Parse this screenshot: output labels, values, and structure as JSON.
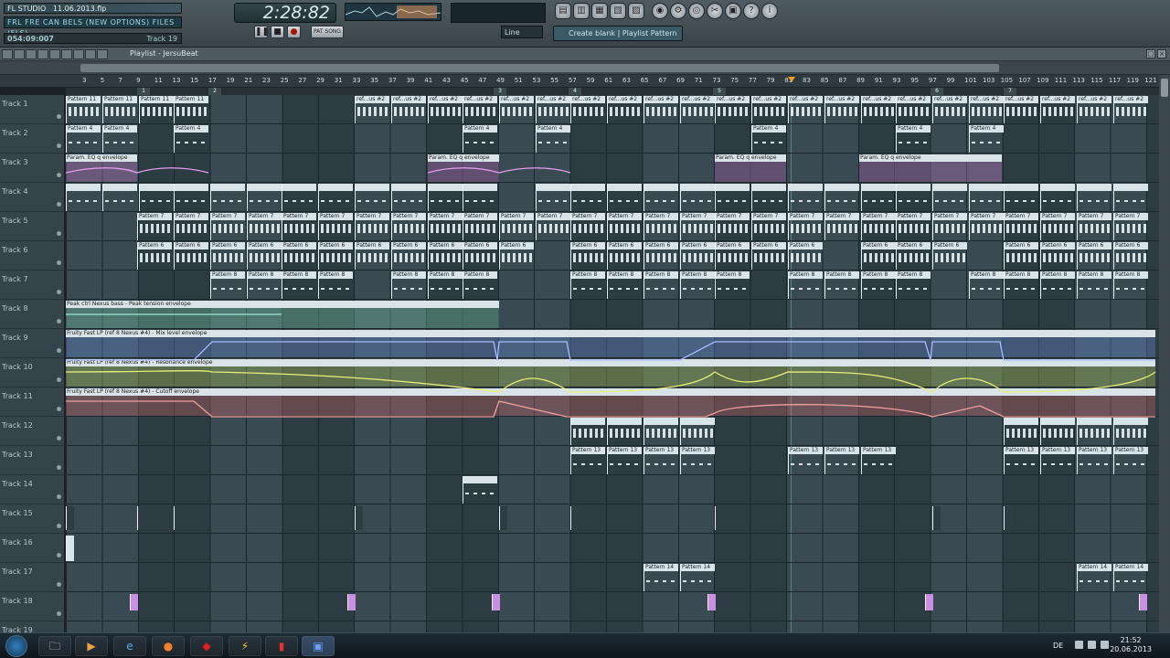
{
  "app": {
    "logo_text": "FL STUDIO",
    "project_date": "11.06.2013.flp",
    "hint_text": "FRL FRE CAN BELS (NEW OPTIONS) FILES (FLS)",
    "position": "054:09:007",
    "selected_track": "Track 19",
    "song_time": "2:28:82",
    "snap_value": "Line",
    "pattern_selector": "Create blank | Playlist Pattern",
    "accent_color": "#f0a020"
  },
  "transport": {
    "pause_label": "❚❚",
    "stop_label": "■",
    "record_label": "●",
    "pat_song_label": "PAT SONG"
  },
  "toolbar_icons": [
    "playlist-icon",
    "piano-roll-icon",
    "browser-icon",
    "channel-rack-icon",
    "mixer-icon",
    "plugin-icon",
    "settings-icon",
    "render-icon",
    "cut-icon",
    "help-icon"
  ],
  "playlist": {
    "title": "Playlist - JersuBeat",
    "ruler_labels": [
      "3",
      "5",
      "7",
      "9",
      "11",
      "13",
      "15",
      "17",
      "19",
      "21",
      "23",
      "25",
      "27",
      "29",
      "31",
      "33",
      "35",
      "37",
      "39",
      "41",
      "43",
      "45",
      "47",
      "49",
      "51",
      "53",
      "55",
      "57",
      "59",
      "61",
      "63",
      "65",
      "67",
      "69",
      "71",
      "73",
      "75",
      "77",
      "79",
      "81",
      "83",
      "85",
      "87",
      "89",
      "91",
      "93",
      "95",
      "97",
      "99",
      "101",
      "103",
      "105",
      "107",
      "109",
      "111",
      "113",
      "115",
      "117",
      "119",
      "121"
    ],
    "loop_markers": [
      "1",
      "2",
      "3",
      "4",
      "5",
      "6",
      "7",
      "8"
    ],
    "tracks": [
      "Track 1",
      "Track 2",
      "Track 3",
      "Track 4",
      "Track 5",
      "Track 6",
      "Track 7",
      "Track 8",
      "Track 9",
      "Track 10",
      "Track 11",
      "Track 12",
      "Track 13",
      "Track 14",
      "Track 15",
      "Track 16",
      "Track 17",
      "Track 18",
      "Track 19"
    ],
    "envelope_labels": {
      "track3": "Param. EQ  q envelope",
      "track8": "Peak ctrl Nexus bass - Peak tension envelope",
      "track9": "Fruity Fast LP (ref 8 Nexus #4) - Mix level envelope",
      "track10": "Fruity Fast LP (ref 8 Nexus #4) - Resonance envelope",
      "track11": "Fruity Fast LP (ref 8 Nexus #4) - Cutoff envelope"
    },
    "pattern_names": {
      "p11": "Pattern 11",
      "p4": "Pattern 4",
      "p7": "Pattern 7",
      "p9": "Pattern 9",
      "p6": "Pattern 6",
      "p8": "Pattern 8",
      "p13": "Pattern 13",
      "p14": "Pattern 14",
      "ref": "ref...us #2"
    }
  },
  "taskbar": {
    "language": "DE",
    "time": "21:52",
    "date": "20.06.2013",
    "apps": [
      "start-icon",
      "explorer-icon",
      "media-player-icon",
      "internet-explorer-icon",
      "firefox-icon",
      "app-icon",
      "winamp-icon",
      "pdf-icon",
      "fl-studio-icon"
    ]
  }
}
